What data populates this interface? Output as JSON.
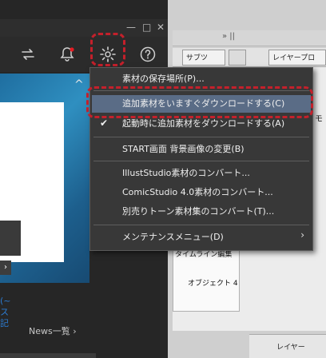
{
  "menu": {
    "items": [
      {
        "label": "素材の保存場所(P)..."
      },
      {
        "label": "追加素材をいますぐダウンロードする(C)"
      },
      {
        "label": "起動時に追加素材をダウンロードする(A)",
        "checked": true
      },
      {
        "label": "START画面 背景画像の変更(B)"
      },
      {
        "label": "IllustStudio素材のコンバート..."
      },
      {
        "label": "ComicStudio 4.0素材のコンバート..."
      },
      {
        "label": "別売りトーン素材集のコンバート(T)..."
      },
      {
        "label": "メンテナンスメニュー(D)"
      }
    ],
    "check_glyph": "✔",
    "submenu_glyph": "›"
  },
  "launcher": {
    "window_buttons": {
      "minimize": "—",
      "maximize": "□",
      "close": "✕"
    },
    "news_label": "News一覧 ›",
    "side_text": "(~\nス\n記",
    "collapse_glyph": "^",
    "nav_glyph": "›"
  },
  "app": {
    "top_arrows": "» ||",
    "tabs": {
      "sub": "サブツ",
      "layer": "レイヤープロ"
    },
    "sub_panel": {
      "timeline": "タイムライン編集",
      "object": "オブジェクト 4"
    },
    "side_label": "モ",
    "bottom_tab": "レイヤー"
  },
  "icons": {
    "swap": "swap-icon",
    "bell": "bell-icon",
    "gear": "gear-icon",
    "help": "help-icon"
  },
  "colors": {
    "highlight": "#c4202b",
    "menu_bg": "#383838",
    "menu_active": "#5a6c86",
    "notification": "#e51c23",
    "link": "#2c7bd0"
  }
}
